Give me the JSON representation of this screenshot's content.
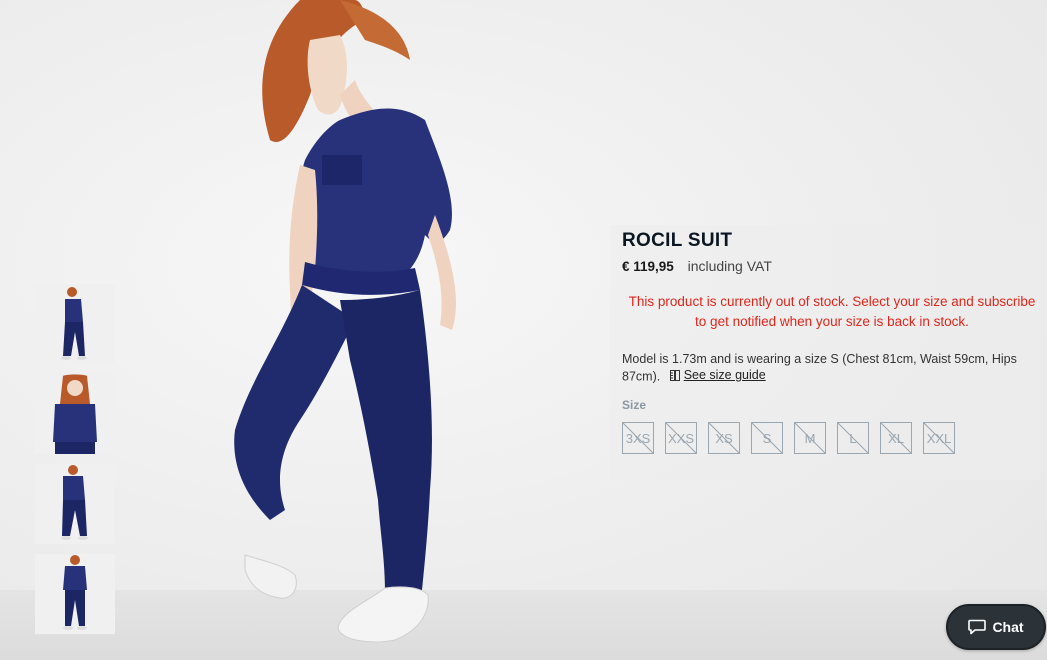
{
  "product": {
    "title": "ROCIL SUIT",
    "price": "€ 119,95",
    "vat_note": "including VAT",
    "stock_message": "This product is currently out of stock. Select your size and subscribe to get notified when your size is back in stock.",
    "model_info": "Model is 1.73m and is wearing a size S (Chest 81cm, Waist 59cm, Hips 87cm).",
    "size_guide_label": "See size guide",
    "size_label": "Size",
    "sizes": [
      {
        "label": "3XS",
        "available": false
      },
      {
        "label": "XXS",
        "available": false
      },
      {
        "label": "XS",
        "available": false
      },
      {
        "label": "S",
        "available": false
      },
      {
        "label": "M",
        "available": false
      },
      {
        "label": "L",
        "available": false
      },
      {
        "label": "XL",
        "available": false
      },
      {
        "label": "XXL",
        "available": false
      }
    ]
  },
  "gallery": {
    "thumbnails": [
      "thumbnail-1",
      "thumbnail-2",
      "thumbnail-3",
      "thumbnail-4"
    ]
  },
  "chat": {
    "label": "Chat",
    "icon": "chat-bubble-icon"
  },
  "colors": {
    "out_of_stock": "#e0261b",
    "title": "#0a1722",
    "size_border": "#9aa6b0",
    "garment": "#1e2a6b",
    "chat_bg": "#2b3338"
  }
}
